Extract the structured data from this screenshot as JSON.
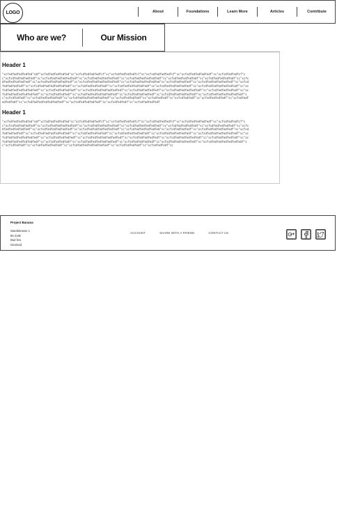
{
  "header": {
    "logo_text": "LOGO",
    "nav": [
      {
        "label": "About"
      },
      {
        "label": "Foundations"
      },
      {
        "label": "Learn More"
      },
      {
        "label": "Articles"
      },
      {
        "label": "Contribute"
      }
    ]
  },
  "tabs": [
    {
      "label": "Who are we?"
    },
    {
      "label": "Our Mission"
    }
  ],
  "content": {
    "sections": [
      {
        "heading": "Header 1",
        "body": "\"xcfsdfedfedfedfed\"sdf\"xcfsdfedfedfedfed\"sc\"xcfsdfedfedfedfcf\"sc\"xcfsdfedfedfedfcf\"sc\"xcfsdfedfedfedfcf\"sc\"xcfsdfedfedfedfedf\"sc\"xcfsdfedfedfcf\"sc\"xcfsdfedfedfedfedf\"sc\"xcfsdfedfedfedfedfedf\"sc\"xcfsdfedfedfedfedfedf\"sc\"xcfsdfedfedfedfedfedf\"sc\"xcfsdfedfedfedfedf\"sc\"xcfsdfedfedfedfedf\"sc\"xcfsdfedfedfedfedfedf\"sc\"xcfsdfedfedfedfedfedf\"sc\"xcfsdfedfedfedfedfedfedf\"sc\"xcfsdfedfedfedfedfed\"sc\"xcfsdfedfedfedf\"sc\"xcfsdfedfedfedfedfedf\"sc\"xcfsdfedfedfedfedf\"sc\"xcfsdfedfedfedfedfedfedf\"sc\"xcfsdfedfedfedfedf\"sc\"xcfsdfedfedfedfedfedf\"sc\"xcfsdfedfedfedfedfedf\"sc\"xcfsdfedfedfedfedfedfedf\"sc\"xcfsdfedfedfedfedfedfedf\"sc\"xcfsdfedfedfedfedf\"sc\"xcfsdfedfedfedfedfedfedf\"sc\"xcfsdfedfedfedfedf\"sc\"xcfsdfedfedfedfedfedf\"sc\"xcfsdfedfedfedfedf\"sc\"xcfsdfedfedfedfedfedfedf\"sc\"xcfsdfedfedfedf\"sc\"xcfsdfedfedfedfedfedfedf\"sc\"xcfsdfedfedfedfedf\"sc\"xcfsdfedfedfedfedfedf\"sc\"xcfsdfedfedfedfedfedfedf\"sc\"xcfsdfedfedf\"sc\"xcfsdfedfedfedfedf\"sc\"xcfsdfedfedfedfedfedfedf\"sc\"xcfsdfedfedfedf\"sc\"xcfsdfedfedf\"sc\"xcfsdfedfedf\"sc\"xcfsdfedfedfedf\"sc\"xcfsdfedfedfedfedf\"sc\"xcfsdfedfedfedfedfedfedf\"sc\"xcfsdfedfedfedfedf\"sc\"xcfsdfedfedf\"sc\"xcfsdfedfedfedf"
      },
      {
        "heading": "Header 1",
        "body": "\"xcfsdfedfedfedfed\"sdf\"xcfsdfedfedfedfed\"sc\"xcfsdfedfedfedfcf\"sc\"xcfsdfedfedfedfcf\"sc\"xcfsdfedfedfedfcf\"sc\"xcfsdfedfedfedfedf\"sc\"xcfsdfedfedfcf\"sc\"xcfsdfedfedfedfedf\"sc\"xcfsdfedfedfedfedfedf\"sc\"xcfsdfedfedfedfedfedf\"sc\"xcfsdfedfedfedfedfedf\"sc\"xcfsdfedfedfedfedf\"sc\"xcfsdfedfedfedfedf\"sc\"xcfsdfedfedfedfedfedf\"sc\"xcfsdfedfedfedfedfedf\"sc\"xcfsdfedfedfedfedfedfedf\"sc\"xcfsdfedfedfedfedfed\"sc\"xcfsdfedfedfedf\"sc\"xcfsdfedfedfedfedfedf\"sc\"xcfsdfedfedfedfedf\"sc\"xcfsdfedfedfedfedfedfedf\"sc\"xcfsdfedfedfedfedf\"sc\"xcfsdfedfedfedfedfedf\"sc\"xcfsdfedfedfedfedfedf\"sc\"xcfsdfedfedfedfedfedfedf\"sc\"xcfsdfedfedfedfedfedfedf\"sc\"xcfsdfedfedfedfedf\"sc\"xcfsdfedfedfedfedfedfedf\"sc\"xcfsdfedfedfedfedf\"sc\"xcfsdfedfedfedfedfedf\"sc\"xcfsdfedfedfedfedf\"sc\"xcfsdfedfedfedfedfedfedf\"sc\"xcfsdfedfedfedf\"sc\"xcfsdfedfedfedfedfedfedf\"sc\"xcfsdfedfedfedfedf\"sc\"xcfsdfedfedfedfedfedf\"sc\"xcfsdfedfedfedfedfedfedf\"sc\"xcfsdfedfedf\"sc\"xcfsdfedfedfedfedf\"sc\"xcfsdfedfedfedfedfedfedf\"sc\"xcfsdfedfedfedf\"sc\"xcfsdfedfedf\"sc"
      }
    ]
  },
  "footer": {
    "brand": "Project Banana",
    "address_lines": [
      "Wardtstrasse 1",
      "86 218k",
      "Bad few",
      "Nicoland"
    ],
    "links": [
      {
        "label": "ACCOUNT"
      },
      {
        "label": "SHARE WITH A FRIEND"
      },
      {
        "label": "CONTACT US"
      }
    ],
    "social": [
      {
        "icon": "google-plus-icon"
      },
      {
        "icon": "facebook-icon"
      },
      {
        "icon": "twitter-icon"
      }
    ]
  }
}
